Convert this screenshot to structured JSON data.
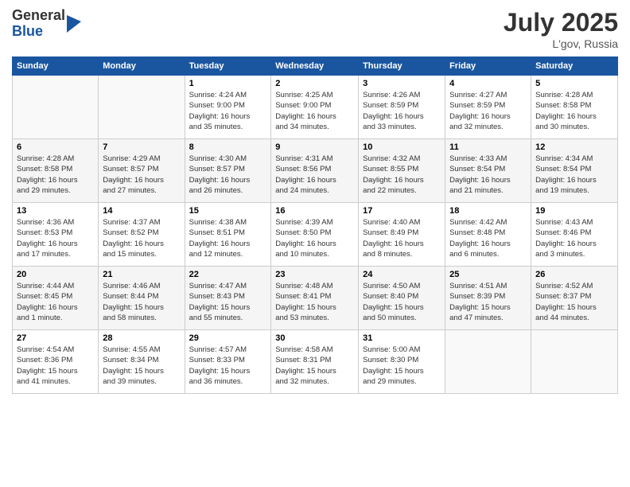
{
  "logo": {
    "general": "General",
    "blue": "Blue"
  },
  "title": {
    "month_year": "July 2025",
    "location": "L'gov, Russia"
  },
  "headers": [
    "Sunday",
    "Monday",
    "Tuesday",
    "Wednesday",
    "Thursday",
    "Friday",
    "Saturday"
  ],
  "weeks": [
    [
      {
        "day": "",
        "info": ""
      },
      {
        "day": "",
        "info": ""
      },
      {
        "day": "1",
        "info": "Sunrise: 4:24 AM\nSunset: 9:00 PM\nDaylight: 16 hours\nand 35 minutes."
      },
      {
        "day": "2",
        "info": "Sunrise: 4:25 AM\nSunset: 9:00 PM\nDaylight: 16 hours\nand 34 minutes."
      },
      {
        "day": "3",
        "info": "Sunrise: 4:26 AM\nSunset: 8:59 PM\nDaylight: 16 hours\nand 33 minutes."
      },
      {
        "day": "4",
        "info": "Sunrise: 4:27 AM\nSunset: 8:59 PM\nDaylight: 16 hours\nand 32 minutes."
      },
      {
        "day": "5",
        "info": "Sunrise: 4:28 AM\nSunset: 8:58 PM\nDaylight: 16 hours\nand 30 minutes."
      }
    ],
    [
      {
        "day": "6",
        "info": "Sunrise: 4:28 AM\nSunset: 8:58 PM\nDaylight: 16 hours\nand 29 minutes."
      },
      {
        "day": "7",
        "info": "Sunrise: 4:29 AM\nSunset: 8:57 PM\nDaylight: 16 hours\nand 27 minutes."
      },
      {
        "day": "8",
        "info": "Sunrise: 4:30 AM\nSunset: 8:57 PM\nDaylight: 16 hours\nand 26 minutes."
      },
      {
        "day": "9",
        "info": "Sunrise: 4:31 AM\nSunset: 8:56 PM\nDaylight: 16 hours\nand 24 minutes."
      },
      {
        "day": "10",
        "info": "Sunrise: 4:32 AM\nSunset: 8:55 PM\nDaylight: 16 hours\nand 22 minutes."
      },
      {
        "day": "11",
        "info": "Sunrise: 4:33 AM\nSunset: 8:54 PM\nDaylight: 16 hours\nand 21 minutes."
      },
      {
        "day": "12",
        "info": "Sunrise: 4:34 AM\nSunset: 8:54 PM\nDaylight: 16 hours\nand 19 minutes."
      }
    ],
    [
      {
        "day": "13",
        "info": "Sunrise: 4:36 AM\nSunset: 8:53 PM\nDaylight: 16 hours\nand 17 minutes."
      },
      {
        "day": "14",
        "info": "Sunrise: 4:37 AM\nSunset: 8:52 PM\nDaylight: 16 hours\nand 15 minutes."
      },
      {
        "day": "15",
        "info": "Sunrise: 4:38 AM\nSunset: 8:51 PM\nDaylight: 16 hours\nand 12 minutes."
      },
      {
        "day": "16",
        "info": "Sunrise: 4:39 AM\nSunset: 8:50 PM\nDaylight: 16 hours\nand 10 minutes."
      },
      {
        "day": "17",
        "info": "Sunrise: 4:40 AM\nSunset: 8:49 PM\nDaylight: 16 hours\nand 8 minutes."
      },
      {
        "day": "18",
        "info": "Sunrise: 4:42 AM\nSunset: 8:48 PM\nDaylight: 16 hours\nand 6 minutes."
      },
      {
        "day": "19",
        "info": "Sunrise: 4:43 AM\nSunset: 8:46 PM\nDaylight: 16 hours\nand 3 minutes."
      }
    ],
    [
      {
        "day": "20",
        "info": "Sunrise: 4:44 AM\nSunset: 8:45 PM\nDaylight: 16 hours\nand 1 minute."
      },
      {
        "day": "21",
        "info": "Sunrise: 4:46 AM\nSunset: 8:44 PM\nDaylight: 15 hours\nand 58 minutes."
      },
      {
        "day": "22",
        "info": "Sunrise: 4:47 AM\nSunset: 8:43 PM\nDaylight: 15 hours\nand 55 minutes."
      },
      {
        "day": "23",
        "info": "Sunrise: 4:48 AM\nSunset: 8:41 PM\nDaylight: 15 hours\nand 53 minutes."
      },
      {
        "day": "24",
        "info": "Sunrise: 4:50 AM\nSunset: 8:40 PM\nDaylight: 15 hours\nand 50 minutes."
      },
      {
        "day": "25",
        "info": "Sunrise: 4:51 AM\nSunset: 8:39 PM\nDaylight: 15 hours\nand 47 minutes."
      },
      {
        "day": "26",
        "info": "Sunrise: 4:52 AM\nSunset: 8:37 PM\nDaylight: 15 hours\nand 44 minutes."
      }
    ],
    [
      {
        "day": "27",
        "info": "Sunrise: 4:54 AM\nSunset: 8:36 PM\nDaylight: 15 hours\nand 41 minutes."
      },
      {
        "day": "28",
        "info": "Sunrise: 4:55 AM\nSunset: 8:34 PM\nDaylight: 15 hours\nand 39 minutes."
      },
      {
        "day": "29",
        "info": "Sunrise: 4:57 AM\nSunset: 8:33 PM\nDaylight: 15 hours\nand 36 minutes."
      },
      {
        "day": "30",
        "info": "Sunrise: 4:58 AM\nSunset: 8:31 PM\nDaylight: 15 hours\nand 32 minutes."
      },
      {
        "day": "31",
        "info": "Sunrise: 5:00 AM\nSunset: 8:30 PM\nDaylight: 15 hours\nand 29 minutes."
      },
      {
        "day": "",
        "info": ""
      },
      {
        "day": "",
        "info": ""
      }
    ]
  ]
}
